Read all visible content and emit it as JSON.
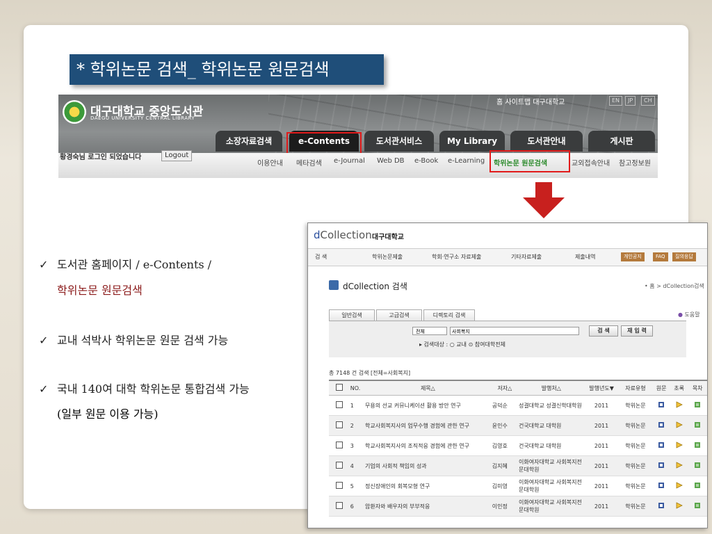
{
  "slide": {
    "title": "* 학위논문 검색_ 학위논문 원문검색",
    "bullets": [
      {
        "mark": "✓",
        "line1": "도서관 홈페이지 / e-Contents /",
        "line2": "학위논문 원문검색"
      },
      {
        "mark": "✓",
        "line1": "교내 석박사 학위논문 원문 검색 가능"
      },
      {
        "mark": "✓",
        "line1": "국내 140여 대학 학위논문 통합검색 가능",
        "line2": "(일부 원문 이용 가능)"
      }
    ]
  },
  "library": {
    "logo_ko": "대구대학교 중앙도서관",
    "logo_en": "DAEGU UNIVERSITY CENTRAL LIBRARY",
    "top_links": "홈   사이트맵   대구대학교",
    "langs": [
      "EN",
      "JP",
      "CH"
    ],
    "tabs": [
      "소장자료검색",
      "e-Contents",
      "도서관서비스",
      "My Library",
      "도서관안내",
      "게시판"
    ],
    "login_text": "황경숙님 로그인 되었습니다",
    "logout": "Logout",
    "submenu": [
      "이용안내",
      "메타검색",
      "e-Journal",
      "Web DB",
      "e-Book",
      "e-Learning",
      "학위논문 원문검색",
      "교외접속안내",
      "참고정보원"
    ]
  },
  "dcollection": {
    "brand_pre": "d",
    "brand_main": "Collection",
    "school": "대구대학교",
    "top_menu": [
      "검  색",
      "학위논문제출",
      "학회·연구소 자료제출",
      "기타자료제출",
      "제출내역"
    ],
    "pills": [
      "개인공지",
      "FAQ",
      "질의응답"
    ],
    "section_title": "dCollection 검색",
    "breadcrumb": "• 홈 > dCollection검색",
    "search_tabs": [
      "일반검색",
      "고급검색",
      "디렉토리 검색"
    ],
    "help": "도움말",
    "select_value": "전체",
    "query": "사회복지",
    "search_btn": "검  색",
    "reset_btn": "재 입 력",
    "target_label": "▸ 검색대상    :  ○ 교내  ⊙ 참여대학전체",
    "result_count": "총 7148 건 검색  [전체=사회복지]",
    "columns": [
      "NO.",
      "제목△",
      "저자△",
      "발행처△",
      "발행년도▼",
      "자료유형",
      "원문",
      "초록",
      "목차"
    ],
    "rows": [
      {
        "no": "1",
        "title": "무용의 선교 커뮤니케이션 활용 방안 연구",
        "author": "공덕순",
        "publisher": "성결대학교 성결신학대학원",
        "year": "2011",
        "type": "학위논문"
      },
      {
        "no": "2",
        "title": "학교사회복지사의 업무수행 경험에 관한 연구",
        "author": "윤인수",
        "publisher": "건국대학교 대학원",
        "year": "2011",
        "type": "학위논문"
      },
      {
        "no": "3",
        "title": "학교사회복지사의 조직적응 경험에 관한 연구",
        "author": "김영호",
        "publisher": "건국대학교 대학원",
        "year": "2011",
        "type": "학위논문"
      },
      {
        "no": "4",
        "title": "기업의 사회적 책임의 성과",
        "author": "김지혜",
        "publisher": "이화여자대학교 사회복지전문대학원",
        "year": "2011",
        "type": "학위논문"
      },
      {
        "no": "5",
        "title": "정신장애인의 회복모형 연구",
        "author": "김미영",
        "publisher": "이화여자대학교 사회복지전문대학원",
        "year": "2011",
        "type": "학위논문"
      },
      {
        "no": "6",
        "title": "암환자와 배우자의 부부적응",
        "author": "이인정",
        "publisher": "이화여자대학교 사회복지전문대학원",
        "year": "2011",
        "type": "학위논문"
      }
    ]
  },
  "colors": {
    "title_bg": "#1f4e79",
    "highlight": "#e21a1a",
    "arrow": "#c8201e",
    "accent_red_text": "#8b1a1a"
  }
}
